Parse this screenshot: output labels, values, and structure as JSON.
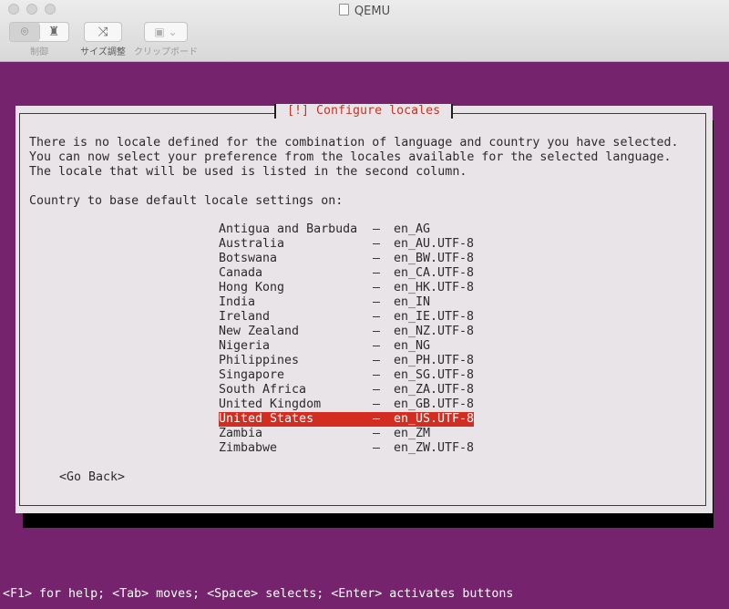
{
  "window": {
    "title": "QEMU"
  },
  "toolbar": {
    "control_label": "制御",
    "resize_label": "サイズ調整",
    "clipboard_label": "クリップボード"
  },
  "dialog": {
    "title": "[!] Configure locales",
    "message": [
      "There is no locale defined for the combination of language and country you have selected.",
      "You can now select your preference from the locales available for the selected language.",
      "The locale that will be used is listed in the second column."
    ],
    "prompt": "Country to base default locale settings on:",
    "dash": "–",
    "items": [
      {
        "country": "Antigua and Barbuda",
        "locale": "en_AG"
      },
      {
        "country": "Australia",
        "locale": "en_AU.UTF-8"
      },
      {
        "country": "Botswana",
        "locale": "en_BW.UTF-8"
      },
      {
        "country": "Canada",
        "locale": "en_CA.UTF-8"
      },
      {
        "country": "Hong Kong",
        "locale": "en_HK.UTF-8"
      },
      {
        "country": "India",
        "locale": "en_IN"
      },
      {
        "country": "Ireland",
        "locale": "en_IE.UTF-8"
      },
      {
        "country": "New Zealand",
        "locale": "en_NZ.UTF-8"
      },
      {
        "country": "Nigeria",
        "locale": "en_NG"
      },
      {
        "country": "Philippines",
        "locale": "en_PH.UTF-8"
      },
      {
        "country": "Singapore",
        "locale": "en_SG.UTF-8"
      },
      {
        "country": "South Africa",
        "locale": "en_ZA.UTF-8"
      },
      {
        "country": "United Kingdom",
        "locale": "en_GB.UTF-8"
      },
      {
        "country": "United States",
        "locale": "en_US.UTF-8",
        "selected": true
      },
      {
        "country": "Zambia",
        "locale": "en_ZM"
      },
      {
        "country": "Zimbabwe",
        "locale": "en_ZW.UTF-8"
      }
    ],
    "go_back": "<Go Back>"
  },
  "help_bar": "<F1> for help; <Tab> moves; <Space> selects; <Enter> activates buttons",
  "colors": {
    "screen_bg": "#75236c",
    "dialog_bg": "#e8e4e8",
    "title_text": "#cc3322",
    "selection_bg": "#d32d21"
  },
  "icons": {
    "control": [
      "pointer-capture-icon",
      "binoculars-icon"
    ],
    "resize": "shrink-arrows-icon",
    "clipboard": "clipboard-icon"
  }
}
